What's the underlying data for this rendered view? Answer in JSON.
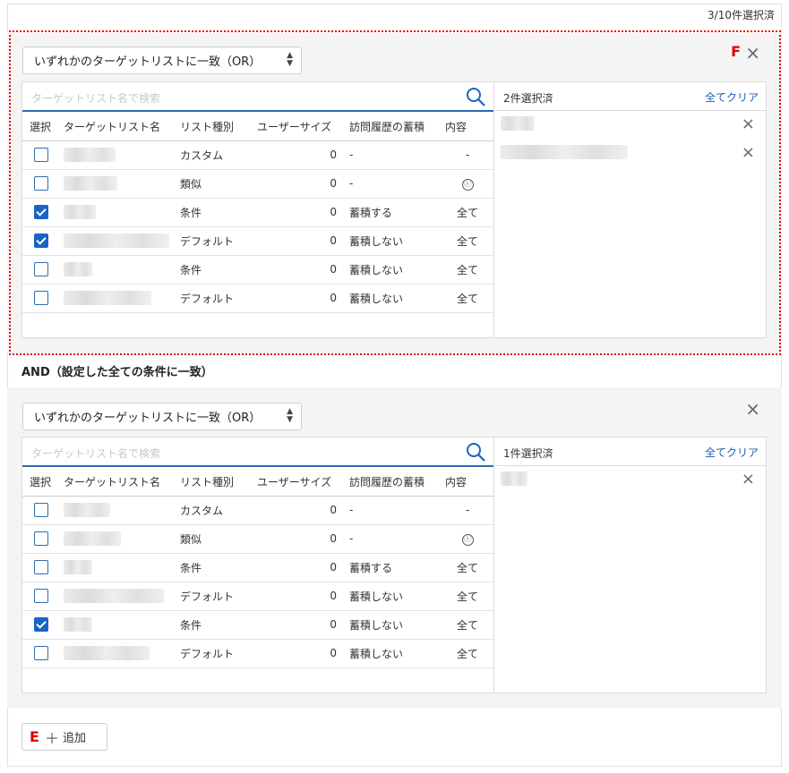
{
  "header": {
    "selected_count": "3/10件選択済"
  },
  "markers": {
    "f": "F",
    "e": "E"
  },
  "colors": {
    "accent": "#1a63c7",
    "link": "#1a5fb4",
    "highlight": "#e00000"
  },
  "icons": {
    "close": "close-icon",
    "search": "search-icon",
    "info": "info-icon",
    "plus": "plus-icon",
    "sort": "sort-arrows-icon"
  },
  "groups": [
    {
      "match_select": "いずれかのターゲットリストに一致（OR）",
      "search_placeholder": "ターゲットリスト名で検索",
      "columns": [
        "選択",
        "ターゲットリスト名",
        "リスト種別",
        "ユーザーサイズ",
        "訪問履歴の蓄積",
        "内容"
      ],
      "rows": [
        {
          "checked": false,
          "type": "カスタム",
          "size": "0",
          "history": "-",
          "content": "-"
        },
        {
          "checked": false,
          "type": "類似",
          "size": "0",
          "history": "-",
          "content": "ⓘ"
        },
        {
          "checked": true,
          "type": "条件",
          "size": "0",
          "history": "蓄積する",
          "content": "全て"
        },
        {
          "checked": true,
          "type": "デフォルト",
          "size": "0",
          "history": "蓄積しない",
          "content": "全て"
        },
        {
          "checked": false,
          "type": "条件",
          "size": "0",
          "history": "蓄積しない",
          "content": "全て"
        },
        {
          "checked": false,
          "type": "デフォルト",
          "size": "0",
          "history": "蓄積しない",
          "content": "全て"
        }
      ],
      "selected_label": "2件選択済",
      "clear_label": "全てクリア"
    },
    {
      "match_select": "いずれかのターゲットリストに一致（OR）",
      "search_placeholder": "ターゲットリスト名で検索",
      "columns": [
        "選択",
        "ターゲットリスト名",
        "リスト種別",
        "ユーザーサイズ",
        "訪問履歴の蓄積",
        "内容"
      ],
      "rows": [
        {
          "checked": false,
          "type": "カスタム",
          "size": "0",
          "history": "-",
          "content": "-"
        },
        {
          "checked": false,
          "type": "類似",
          "size": "0",
          "history": "-",
          "content": "ⓘ"
        },
        {
          "checked": false,
          "type": "条件",
          "size": "0",
          "history": "蓄積する",
          "content": "全て"
        },
        {
          "checked": false,
          "type": "デフォルト",
          "size": "0",
          "history": "蓄積しない",
          "content": "全て"
        },
        {
          "checked": true,
          "type": "条件",
          "size": "0",
          "history": "蓄積しない",
          "content": "全て"
        },
        {
          "checked": false,
          "type": "デフォルト",
          "size": "0",
          "history": "蓄積しない",
          "content": "全て"
        }
      ],
      "selected_label": "1件選択済",
      "clear_label": "全てクリア"
    }
  ],
  "and_label": "AND（設定した全ての条件に一致）",
  "add_button": {
    "label": "追加"
  }
}
